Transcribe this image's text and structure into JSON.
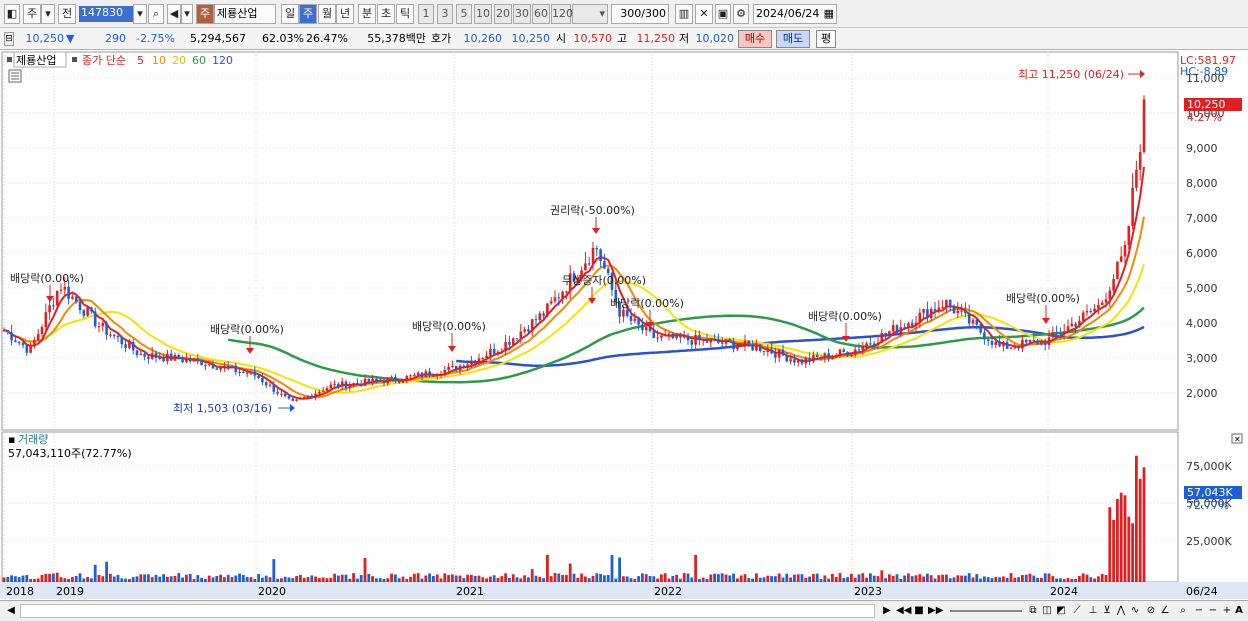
{
  "toolbar": {
    "mode": "주",
    "prev": "전",
    "code": "147830",
    "market_tag": "주",
    "stock_name": "제룡산업",
    "periods": [
      "일",
      "주",
      "월",
      "년",
      "분",
      "초",
      "틱"
    ],
    "active_period": "주",
    "nums": [
      "1",
      "3",
      "5",
      "10",
      "20",
      "30",
      "60",
      "120"
    ],
    "count": "300",
    "count_total": "/300",
    "date": "2024/06/24"
  },
  "quote": {
    "price": "10,250",
    "dir": "▼",
    "change": "290",
    "rate": "-2.75%",
    "volume": "5,294,567",
    "ratio": "62.03%",
    "turnover": "26.47%",
    "amount": "55,378백만",
    "bid_label": "호가",
    "bid1": "10,260",
    "bid2": "10,250",
    "open_label": "시",
    "open": "10,570",
    "high_label": "고",
    "high": "11,250",
    "low_label": "저",
    "low": "10,020",
    "buy": "매수",
    "sell": "매도",
    "eval": "평"
  },
  "legend": {
    "name": "제룡산업",
    "series": "종가 단순",
    "mas": [
      "5",
      "10",
      "20",
      "60",
      "120"
    ]
  },
  "price_panel": {
    "lc": "LC:581.97",
    "hc": "HC:-8.89",
    "cur_price": "10,250",
    "cur_rate": "4.27%",
    "max_label": "최고 11,250 (06/24)",
    "min_label": "최저 1,503 (03/16)",
    "ticks": [
      "11,000",
      "10,000",
      "9,000",
      "8,000",
      "7,000",
      "6,000",
      "5,000",
      "4,000",
      "3,000",
      "2,000"
    ],
    "events": [
      "배당락(0.00%)",
      "배당락(0.00%)",
      "배당락(0.00%)",
      "권리락(-50.00%)",
      "무상증자(0.00%)",
      "배당락(0.00%)",
      "배당락(0.00%)",
      "배당락(0.00%)"
    ]
  },
  "volume_panel": {
    "title": "거래량",
    "value": "57,043,110주(72.77%)",
    "cur": "57,043K",
    "cur_rate": "72.77%",
    "ticks": [
      "75,000K",
      "50,000K",
      "25,000K"
    ]
  },
  "xaxis": {
    "years": [
      "2018",
      "2019",
      "2020",
      "2021",
      "2022",
      "2023",
      "2024"
    ],
    "last": "06/24"
  },
  "colors": {
    "up": "#e02020",
    "down": "#1f5fd6",
    "ma5": "#e02020",
    "ma10": "#f08a00",
    "ma20": "#f5e400",
    "ma60": "#2e9a47",
    "ma120": "#2c4fd6"
  },
  "chart_data": {
    "type": "candlestick",
    "x": [
      "2018",
      "2018-07",
      "2019",
      "2019-04",
      "2019-07",
      "2019-10",
      "2020",
      "2020-03",
      "2020-06",
      "2020-09",
      "2021",
      "2021-04",
      "2021-07",
      "2021-09",
      "2021-10",
      "2022",
      "2022-04",
      "2022-07",
      "2022-10",
      "2023",
      "2023-04",
      "2023-07",
      "2023-10",
      "2024",
      "2024-03",
      "2024-05",
      "2024-06"
    ],
    "series": [
      {
        "name": "종가",
        "values": [
          3800,
          3200,
          5100,
          3900,
          3100,
          2900,
          2500,
          1700,
          2200,
          2400,
          2700,
          3300,
          4300,
          6200,
          4300,
          3600,
          3500,
          3300,
          2900,
          3200,
          3900,
          4600,
          3300,
          3500,
          4500,
          6000,
          10250
        ]
      }
    ],
    "ylim": [
      1000,
      11500
    ]
  }
}
